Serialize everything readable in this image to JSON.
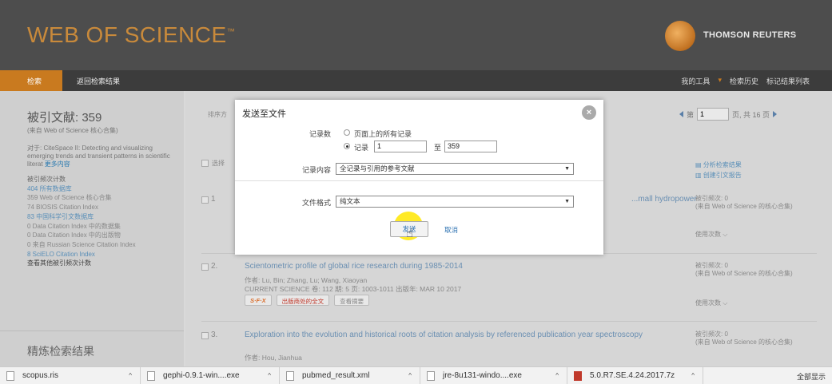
{
  "header": {
    "logo_text": "WEB OF SCIENCE",
    "logo_tm": "™",
    "publisher": "THOMSON REUTERS"
  },
  "nav": {
    "search": "检索",
    "back": "返回检索结果",
    "my_tools": "我的工具",
    "history": "检索历史",
    "marked": "标记结果列表"
  },
  "left": {
    "refs_title": "被引文献: 359",
    "refs_from": "(来自 Web of Science 核心合集)",
    "desc": "对于: CiteSpace II: Detecting and visualizing emerging trends and transient patterns in scientific literat",
    "more": "更多内容",
    "list_title": "被引频次计数",
    "items": [
      {
        "text": "404 所有数据库",
        "style": "lnk"
      },
      {
        "text": "359 Web of Science 核心合集",
        "style": "plain"
      },
      {
        "text": "74 BIOSIS Citation Index",
        "style": "plain"
      },
      {
        "text": "83 中国科学引文数据库",
        "style": "lnk"
      },
      {
        "text": "0 Data Citation Index 中的数据集",
        "style": "plain"
      },
      {
        "text": "0 Data Citation Index 中的出版物",
        "style": "plain"
      },
      {
        "text": "0 来自 Russian Science Citation Index",
        "style": "plain"
      },
      {
        "text": "8 SciELO Citation Index",
        "style": "lnk"
      },
      {
        "text": "查看其他被引频次计数",
        "style": "dark"
      }
    ],
    "refine": "精炼检索结果"
  },
  "main": {
    "sort_label": "排序方",
    "select_label": "选择",
    "page_prefix": "第",
    "page_value": "1",
    "page_suffix": "页, 共 16 页",
    "analyze": "分析检索结果",
    "citation_report": "创建引文报告",
    "records": [
      {
        "num": "1",
        "title": "...mall hydropower",
        "authors": "",
        "journal": "",
        "cites": "被引频次: 0",
        "cites_from": "(来自 Web of Science 的核心合集)",
        "usage": "使用次数"
      },
      {
        "num": "2.",
        "title": "Scientometric profile of global rice research during 1985-2014",
        "authors": "作者: Lu, Bin; Zhang, Lu; Wang, Xiaoyan",
        "journal": "CURRENT SCIENCE  卷: 112  期: 5  页: 1003-1011  出版年: MAR 10 2017",
        "sfx": "S·F·X",
        "fulltext": "出版商处的全文",
        "abstract": "查看摘要",
        "cites": "被引频次: 0",
        "cites_from": "(来自 Web of Science 的核心合集)",
        "usage": "使用次数"
      },
      {
        "num": "3.",
        "title": "Exploration into the evolution and historical roots of citation analysis by referenced publication year spectroscopy",
        "authors": "作者: Hou, Jianhua",
        "journal": "",
        "cites": "被引频次: 0",
        "cites_from": "(来自 Web of Science 的核心合集)",
        "usage": ""
      }
    ]
  },
  "modal": {
    "title": "发送至文件",
    "records_label": "记录数",
    "opt_all_page": "页面上的所有记录",
    "opt_records": "记录",
    "from_value": "1",
    "to_label": "至",
    "to_value": "359",
    "content_label": "记录内容",
    "content_value": "全记录与引用的参考文献",
    "format_label": "文件格式",
    "format_value": "纯文本",
    "send": "发送",
    "cancel": "取消"
  },
  "downloads": {
    "items": [
      {
        "name": "scopus.ris"
      },
      {
        "name": "gephi-0.9.1-win....exe"
      },
      {
        "name": "pubmed_result.xml"
      },
      {
        "name": "jre-8u131-windo....exe"
      },
      {
        "name": "5.0.R7.SE.4.24.2017.7z"
      }
    ],
    "show_all": "全部显示"
  }
}
